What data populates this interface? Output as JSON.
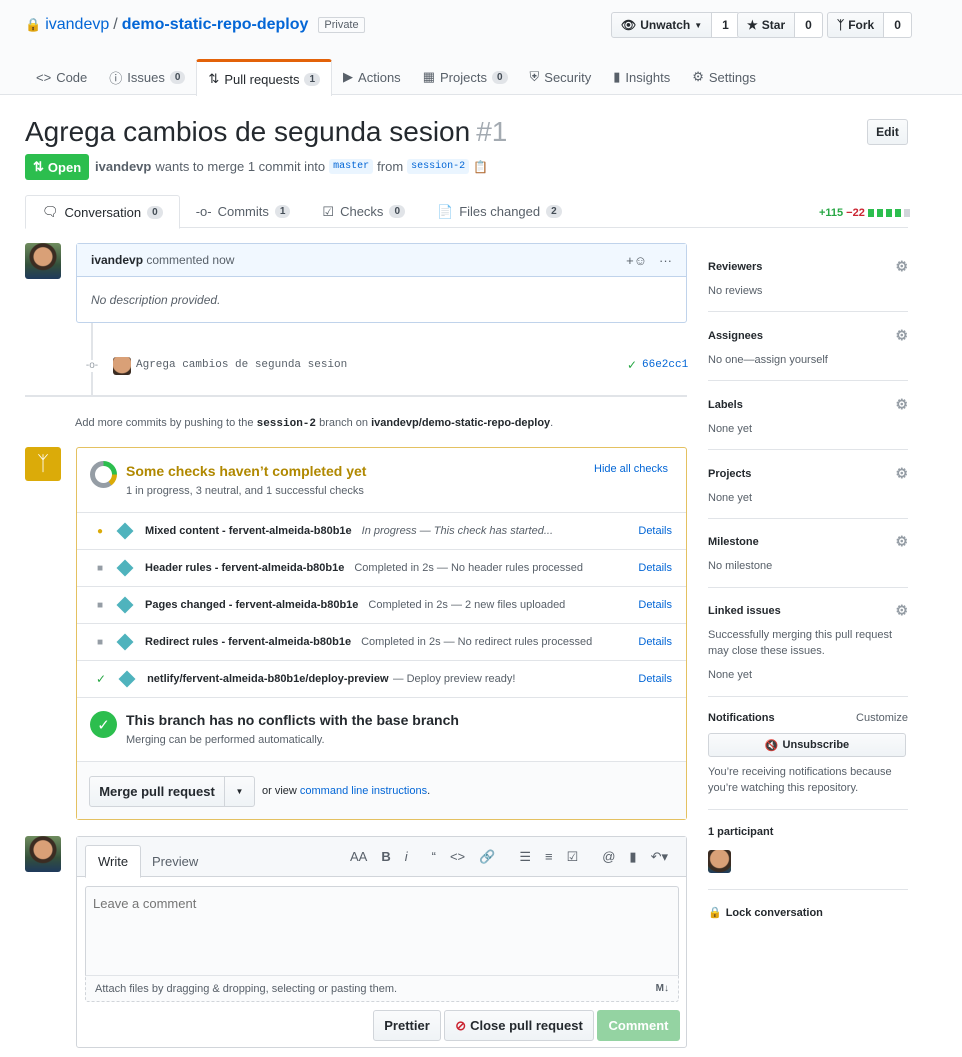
{
  "repo": {
    "owner": "ivandevp",
    "sep": "/",
    "name": "demo-static-repo-deploy",
    "visibility": "Private"
  },
  "actions": {
    "watch": {
      "label": "Unwatch",
      "count": "1"
    },
    "star": {
      "label": "Star",
      "count": "0"
    },
    "fork": {
      "label": "Fork",
      "count": "0"
    }
  },
  "nav": [
    {
      "label": "Code",
      "count": ""
    },
    {
      "label": "Issues",
      "count": "0"
    },
    {
      "label": "Pull requests",
      "count": "1"
    },
    {
      "label": "Actions",
      "count": ""
    },
    {
      "label": "Projects",
      "count": "0"
    },
    {
      "label": "Security",
      "count": ""
    },
    {
      "label": "Insights",
      "count": ""
    },
    {
      "label": "Settings",
      "count": ""
    }
  ],
  "pr": {
    "title": "Agrega cambios de segunda sesion",
    "number": "#1",
    "edit": "Edit",
    "state": "Open",
    "author": "ivandevp",
    "wants": "wants to merge 1 commit into",
    "base": "master",
    "from": "from",
    "head": "session-2"
  },
  "tabs": [
    {
      "label": "Conversation",
      "count": "0"
    },
    {
      "label": "Commits",
      "count": "1"
    },
    {
      "label": "Checks",
      "count": "0"
    },
    {
      "label": "Files changed",
      "count": "2"
    }
  ],
  "diffstat": {
    "add": "+115",
    "del": "−22"
  },
  "comment": {
    "author": "ivandevp",
    "action": "commented now",
    "body": "No description provided."
  },
  "commit": {
    "message": "Agrega cambios de segunda sesion",
    "sha": "66e2cc1"
  },
  "push_hint": {
    "pre": "Add more commits by pushing to the",
    "branch": "session-2",
    "mid": "branch on",
    "repo": "ivandevp/demo-static-repo-deploy",
    "end": "."
  },
  "checks": {
    "title": "Some checks haven’t completed yet",
    "summary": "1 in progress, 3 neutral, and 1 successful checks",
    "hide": "Hide all checks",
    "items": [
      {
        "name": "Mixed content - fervent-almeida-b80b1e",
        "desc": "In progress — This check has started...",
        "details": "Details",
        "status": "pending"
      },
      {
        "name": "Header rules - fervent-almeida-b80b1e",
        "desc": "Completed in 2s — No header rules processed",
        "details": "Details",
        "status": "neutral"
      },
      {
        "name": "Pages changed - fervent-almeida-b80b1e",
        "desc": "Completed in 2s — 2 new files uploaded",
        "details": "Details",
        "status": "neutral"
      },
      {
        "name": "Redirect rules - fervent-almeida-b80b1e",
        "desc": "Completed in 2s — No redirect rules processed",
        "details": "Details",
        "status": "neutral"
      },
      {
        "name": "netlify/fervent-almeida-b80b1e/deploy-preview",
        "desc": "— Deploy preview ready!",
        "details": "Details",
        "status": "success"
      }
    ],
    "noconflict_title": "This branch has no conflicts with the base branch",
    "noconflict_sub": "Merging can be performed automatically.",
    "merge_btn": "Merge pull request",
    "or_view": "or view",
    "cli_link": "command line instructions",
    "cli_end": "."
  },
  "sidebar": {
    "reviewers": {
      "title": "Reviewers",
      "value": "No reviews"
    },
    "assignees": {
      "title": "Assignees",
      "value": "No one—assign yourself"
    },
    "labels": {
      "title": "Labels",
      "value": "None yet"
    },
    "projects": {
      "title": "Projects",
      "value": "None yet"
    },
    "milestone": {
      "title": "Milestone",
      "value": "No milestone"
    },
    "linked": {
      "title": "Linked issues",
      "desc": "Successfully merging this pull request may close these issues.",
      "value": "None yet"
    },
    "notifications": {
      "title": "Notifications",
      "customize": "Customize",
      "button": "Unsubscribe",
      "desc": "You’re receiving notifications because you’re watching this repository."
    },
    "participants": "1 participant",
    "lock": "Lock conversation"
  },
  "editor": {
    "write": "Write",
    "preview": "Preview",
    "placeholder": "Leave a comment",
    "attach": "Attach files by dragging & dropping, selecting or pasting them.",
    "prettier": "Prettier",
    "close": "Close pull request",
    "comment": "Comment"
  },
  "colors": {
    "open": "#2cbe4e",
    "link": "#0366d6",
    "pending": "#dbab09",
    "add": "#28a745",
    "del": "#cb2431"
  }
}
